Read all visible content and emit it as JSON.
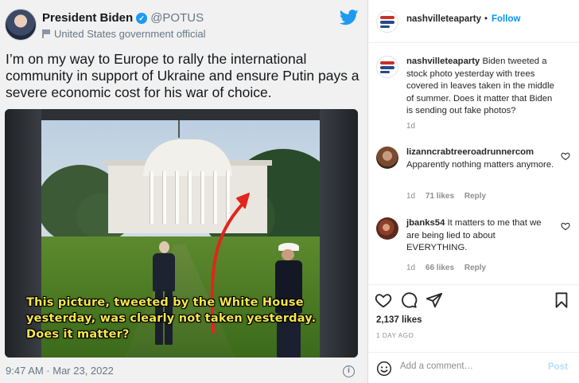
{
  "tweet": {
    "author_name": "President Biden",
    "handle": "@POTUS",
    "affiliation": "United States government official",
    "text": "I’m on my way to Europe to rally the international community in support of Ukraine and ensure Putin pays a severe economic cost for his war of choice.",
    "image_caption_lines": [
      "This picture, tweeted by the White House",
      "yesterday, was clearly not taken yesterday.",
      "Does it matter?"
    ],
    "timestamp": "9:47 AM · Mar 23, 2022",
    "info_symbol": "i",
    "verified_symbol": "✓"
  },
  "post": {
    "username": "nashvilleteaparty",
    "separator": "•",
    "follow_label": "Follow",
    "caption_user": "nashvilleteaparty",
    "caption_text": "Biden tweeted a stock photo yesterday with trees covered in leaves taken in the middle of summer. Does it matter that Biden is sending out fake photos?",
    "caption_age": "1d",
    "comments": [
      {
        "user": "lizanncrabtreeroadrunnercom",
        "text": "Apparently nothing matters anymore.",
        "age": "1d",
        "likes": "71 likes",
        "reply_label": "Reply"
      },
      {
        "user": "jbanks54",
        "text": "It matters to me that we are being lied to about EVERYTHING.",
        "age": "1d",
        "likes": "66 likes",
        "reply_label": "Reply"
      }
    ],
    "likes_count": "2,137 likes",
    "time_ago": "1 DAY AGO",
    "add_comment_placeholder": "Add a comment…",
    "post_label": "Post"
  },
  "colors": {
    "twitter_blue": "#1d9bf0",
    "instagram_link": "#0095f6",
    "caption_yellow": "#f6e64a",
    "arrow_red": "#e0261e"
  }
}
